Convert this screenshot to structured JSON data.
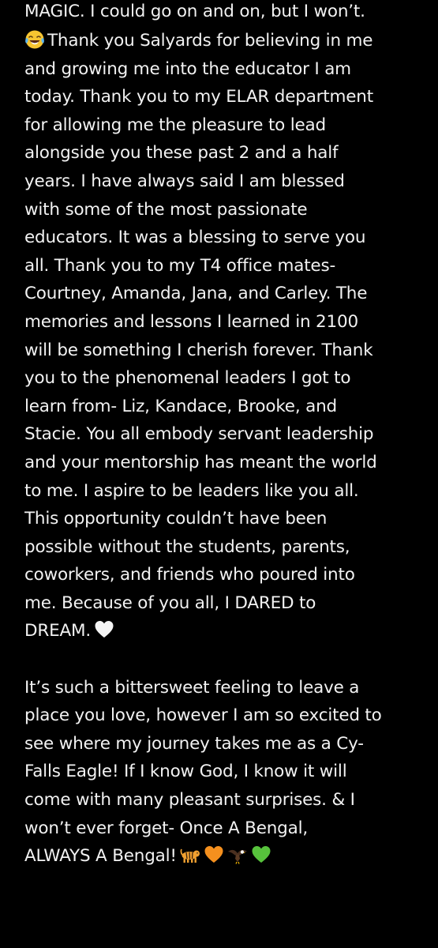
{
  "paragraph1": {
    "lines": [
      "MAGIC. I could go on and on, but I won’t.",
      "Thank you Salyards for believing in me",
      "and growing me into the educator I am",
      "today. Thank you to my ELAR department",
      "for allowing me the pleasure to lead",
      "alongside you these past 2 and a half",
      "years. I have always said I am blessed",
      "with some of the most passionate",
      "educators. It was a blessing to serve you",
      "all. Thank you to my T4 office mates-",
      "Courtney, Amanda, Jana, and Carley. The",
      "memories and lessons I learned in 2100",
      "will be something I cherish forever. Thank",
      "you to the phenomenal leaders I got to",
      "learn from- Liz, Kandace, Brooke, and",
      "Stacie. You all embody servant leadership",
      "and your mentorship has meant the world",
      "to me. I aspire to be leaders like you all.",
      "This opportunity couldn’t have been",
      "possible without the students, parents,",
      "coworkers, and friends who poured into",
      "me. Because of you all, I DARED to",
      "DREAM."
    ]
  },
  "paragraph2": {
    "lines": [
      "It’s such a bittersweet feeling to leave a",
      "place you love, however I am so excited to",
      "see where my journey takes me as a Cy-",
      "Falls Eagle! If I know God, I know it will",
      "come with many pleasant surprises. & I",
      "won’t ever forget- Once A Bengal,",
      "ALWAYS A Bengal!"
    ]
  },
  "icons": {
    "laughing": "face-with-tears-of-joy-icon",
    "white_heart": "white-heart-icon",
    "tiger": "tiger-icon",
    "orange_heart": "orange-heart-icon",
    "eagle": "eagle-icon",
    "green_heart": "green-heart-icon"
  },
  "colors": {
    "background": "#000000",
    "text": "#f2f2f2",
    "orange_heart": "#f5901e",
    "green_heart": "#57c23c",
    "white_heart": "#f4f4f4"
  }
}
